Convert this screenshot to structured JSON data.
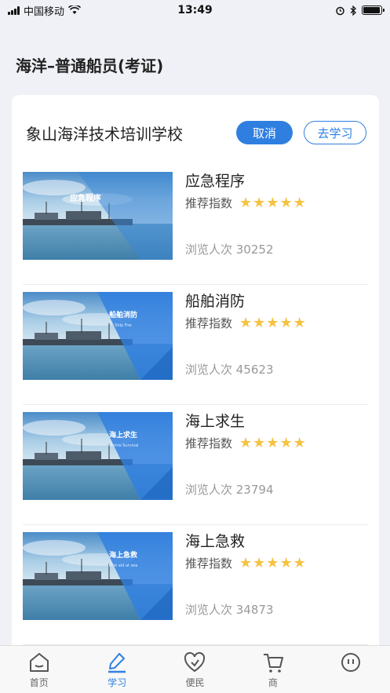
{
  "status_bar": {
    "carrier": "中国移动",
    "time": "13:49",
    "battery_level": 0.95
  },
  "page": {
    "title": "海洋–普通船员(考证)"
  },
  "school": {
    "name": "象山海洋技术培训学校",
    "cancel_label": "取消",
    "study_label": "去学习"
  },
  "courses": [
    {
      "title": "应急程序",
      "rec_label": "推荐指数",
      "stars": 5,
      "views": "浏览人次 30252",
      "thumb_title": "应急程序",
      "thumb_sub": ""
    },
    {
      "title": "船舶消防",
      "rec_label": "推荐指数",
      "stars": 5,
      "views": "浏览人次 45623",
      "thumb_title": "船舶消防",
      "thumb_sub": "Ship Fire"
    },
    {
      "title": "海上求生",
      "rec_label": "推荐指数",
      "stars": 5,
      "views": "浏览人次 23794",
      "thumb_title": "海上求生",
      "thumb_sub": "Marine Survival"
    },
    {
      "title": "海上急救",
      "rec_label": "推荐指数",
      "stars": 5,
      "views": "浏览人次 34873",
      "thumb_title": "海上急救",
      "thumb_sub": "First aid at sea"
    }
  ],
  "tabs": [
    {
      "label": "首页",
      "icon": "home-icon",
      "active": false
    },
    {
      "label": "学习",
      "icon": "pen-icon",
      "active": true
    },
    {
      "label": "便民",
      "icon": "heart-icon",
      "active": false
    },
    {
      "label": "商",
      "icon": "cart-icon",
      "active": false
    },
    {
      "label": "",
      "icon": "profile-icon",
      "active": false
    }
  ],
  "colors": {
    "accent": "#2f7fe1",
    "star": "#f5c342",
    "background": "#f0f1f6"
  }
}
